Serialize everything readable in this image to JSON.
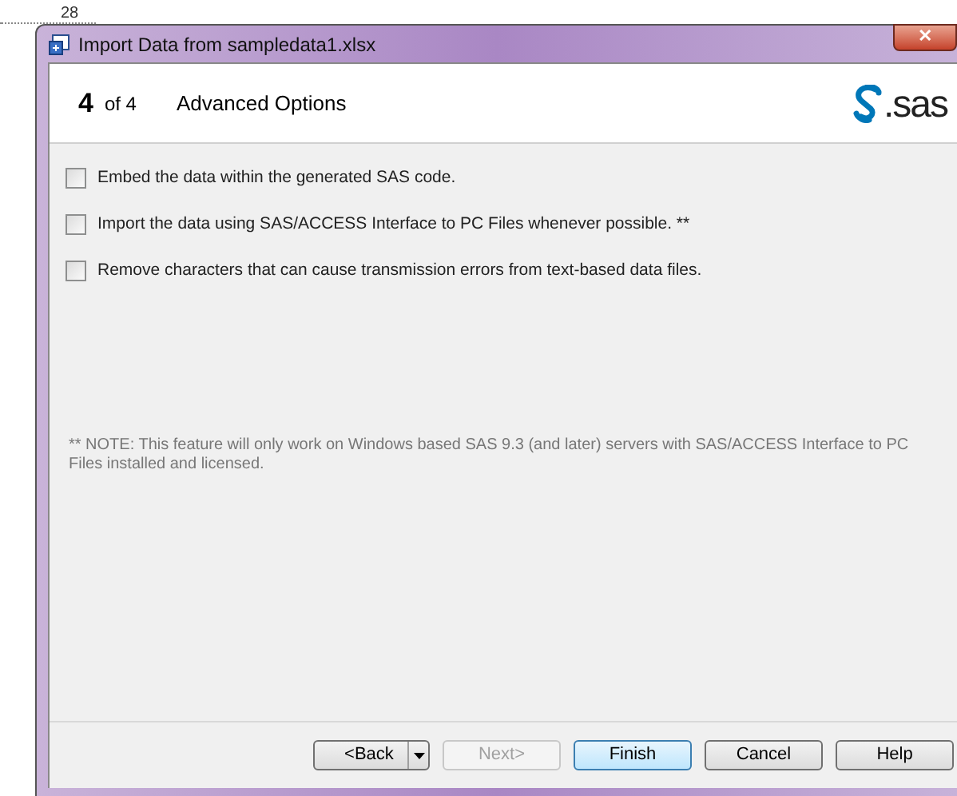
{
  "background": {
    "line_number": "28"
  },
  "window": {
    "title": "Import Data from sampledata1.xlsx",
    "close": "✕"
  },
  "header": {
    "step": "4",
    "step_of": "of 4",
    "title": "Advanced Options",
    "logo_text": ".sas"
  },
  "options": [
    {
      "label": "Embed the data within the generated SAS code.",
      "checked": false
    },
    {
      "label": "Import the data using SAS/ACCESS Interface to PC Files whenever possible. **",
      "checked": false
    },
    {
      "label": "Remove characters that can cause transmission errors from text-based data files.",
      "checked": false
    }
  ],
  "note": "** NOTE: This feature will only work on Windows based SAS 9.3 (and later) servers with SAS/ACCESS Interface to PC Files installed and licensed.",
  "buttons": [
    {
      "label": "<Back",
      "kind": "split",
      "disabled": false,
      "default": false
    },
    {
      "label": "Next>",
      "kind": "plain",
      "disabled": true,
      "default": false
    },
    {
      "label": "Finish",
      "kind": "plain",
      "disabled": false,
      "default": true
    },
    {
      "label": "Cancel",
      "kind": "plain",
      "disabled": false,
      "default": false
    },
    {
      "label": "Help",
      "kind": "plain",
      "disabled": false,
      "default": false
    }
  ]
}
